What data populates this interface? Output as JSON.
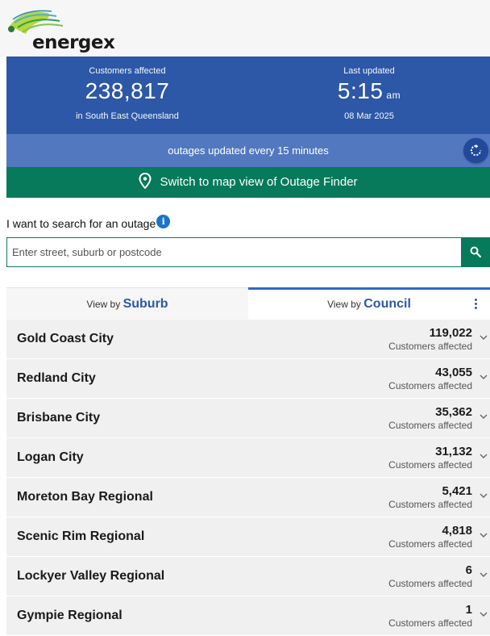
{
  "brand": {
    "name": "energex"
  },
  "stats": {
    "customers_label": "Customers affected",
    "customers_value": "238,817",
    "customers_region": "in South East Queensland",
    "updated_label": "Last updated",
    "updated_time": "5:15",
    "updated_ampm": "am",
    "updated_date": "08 Mar 2025"
  },
  "update_bar": {
    "text": "outages updated every 15 minutes",
    "icon": "refresh-icon"
  },
  "map_link": {
    "text": "Switch to map view of Outage Finder",
    "icon": "map-pin-icon"
  },
  "search": {
    "heading": "I want to search for an outage",
    "info_glyph": "i",
    "placeholder": "Enter street, suburb or postcode",
    "value": ""
  },
  "tabs": [
    {
      "prefix": "View by",
      "label": "Suburb",
      "active": false
    },
    {
      "prefix": "View by",
      "label": "Council",
      "active": true
    }
  ],
  "councils": [
    {
      "name": "Gold Coast City",
      "count": "119,022",
      "sub": "Customers affected"
    },
    {
      "name": "Redland City",
      "count": "43,055",
      "sub": "Customers affected"
    },
    {
      "name": "Brisbane City",
      "count": "35,362",
      "sub": "Customers affected"
    },
    {
      "name": "Logan City",
      "count": "31,132",
      "sub": "Customers affected"
    },
    {
      "name": "Moreton Bay Regional",
      "count": "5,421",
      "sub": "Customers affected"
    },
    {
      "name": "Scenic Rim Regional",
      "count": "4,818",
      "sub": "Customers affected"
    },
    {
      "name": "Lockyer Valley Regional",
      "count": "6",
      "sub": "Customers affected"
    },
    {
      "name": "Gympie Regional",
      "count": "1",
      "sub": "Customers affected"
    }
  ],
  "colors": {
    "header_blue": "#2d58a8",
    "update_blue": "#5278c0",
    "green": "#067a5a",
    "row_bg": "#f0f0f0"
  }
}
